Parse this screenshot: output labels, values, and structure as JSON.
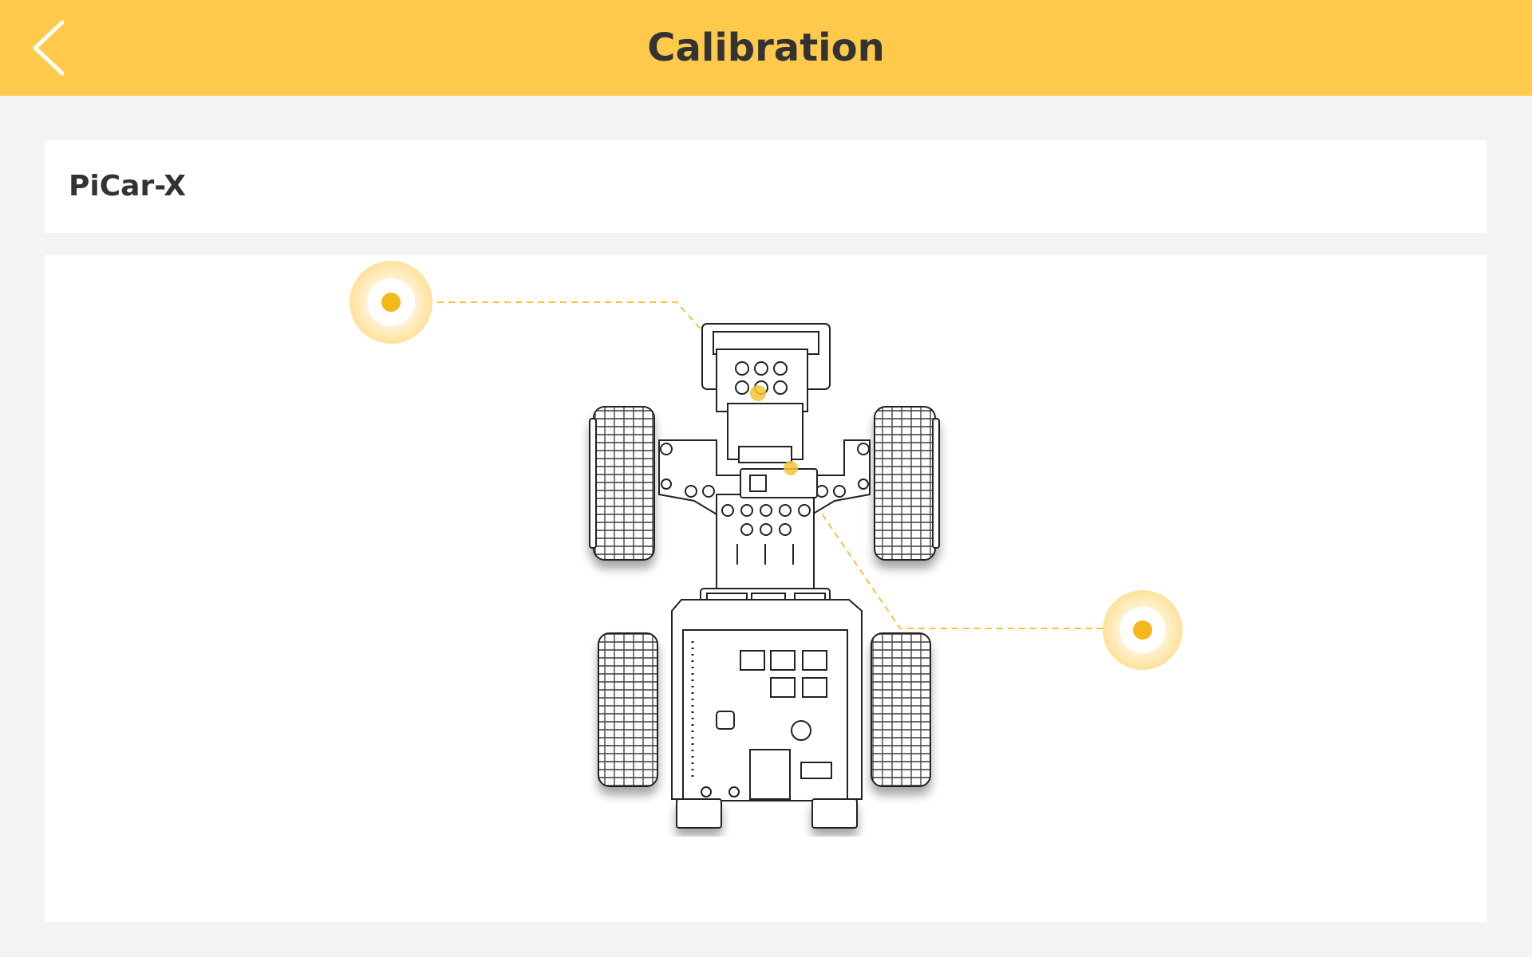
{
  "header": {
    "title": "Calibration",
    "back_icon": "chevron-left-icon",
    "background_color": "#ffc94b"
  },
  "device": {
    "name": "PiCar-X"
  },
  "diagram": {
    "hotspot_color": "#f5b81c",
    "hotspots": [
      {
        "name": "camera-servo-calibration-point",
        "icon": "target-icon"
      },
      {
        "name": "steering-servo-calibration-point",
        "icon": "target-icon"
      }
    ]
  }
}
